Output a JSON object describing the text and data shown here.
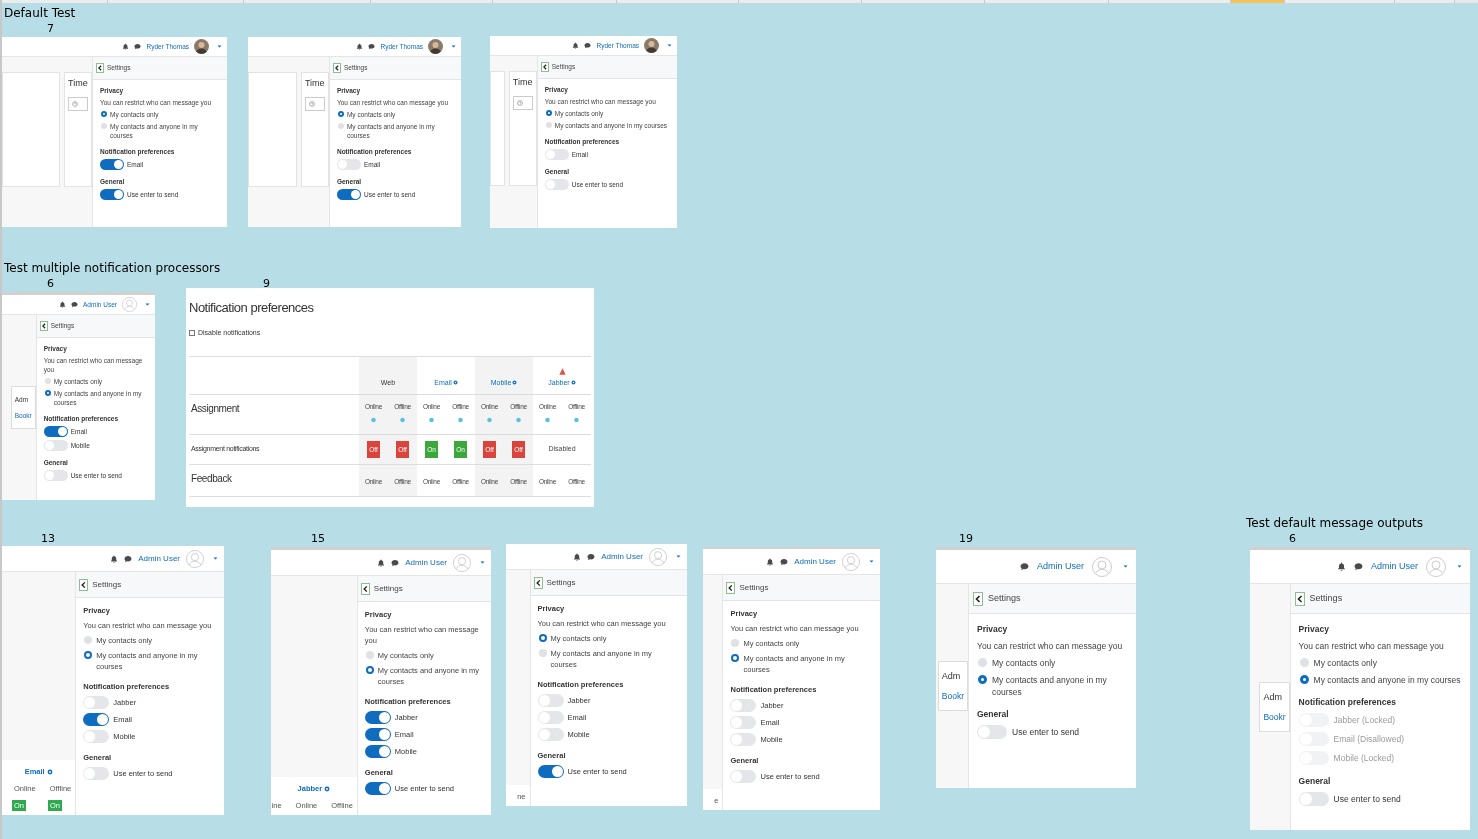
{
  "sheet": {
    "columns": [
      {
        "selected": false
      },
      {
        "selected": false
      },
      {
        "selected": false
      },
      {
        "selected": false
      },
      {
        "selected": false
      },
      {
        "selected": false
      },
      {
        "selected": false
      },
      {
        "selected": false
      },
      {
        "selected": false
      },
      {
        "selected": false
      },
      {
        "selected": true
      },
      {
        "selected": false
      },
      {
        "selected": false
      }
    ]
  },
  "groups": [
    {
      "title": "Default Test",
      "shots": [
        {
          "kind": "settings",
          "label": "7",
          "bell": true,
          "user": "Ryder Thomas",
          "avatar_photo": true,
          "backdrop": [
            {
              "kind": "title",
              "text": "Time"
            }
          ],
          "settings_title": "Settings",
          "privacy": {
            "title": "Privacy",
            "hint": "You can restrict who can message you",
            "options": [
              {
                "label": "My contacts only",
                "selected": true
              },
              {
                "label": "My contacts and anyone in my courses",
                "selected": false
              }
            ]
          },
          "notifications": {
            "title": "Notification preferences",
            "toggles": [
              {
                "label": "Email",
                "on": true
              }
            ]
          },
          "general": {
            "title": "General",
            "toggles": [
              {
                "label": "Use enter to send",
                "on": true
              }
            ]
          }
        },
        {
          "kind": "settings",
          "bell": true,
          "user": "Ryder Thomas",
          "avatar_photo": true,
          "backdrop": [
            {
              "kind": "title",
              "text": "Time"
            }
          ],
          "settings_title": "Settings",
          "privacy": {
            "title": "Privacy",
            "hint": "You can restrict who can message you",
            "options": [
              {
                "label": "My contacts only",
                "selected": true
              },
              {
                "label": "My contacts and anyone in my courses",
                "selected": false
              }
            ]
          },
          "notifications": {
            "title": "Notification preferences",
            "toggles": [
              {
                "label": "Email",
                "on": false
              }
            ]
          },
          "general": {
            "title": "General",
            "toggles": [
              {
                "label": "Use enter to send",
                "on": true
              }
            ]
          }
        },
        {
          "kind": "settings",
          "bell": true,
          "user": "Ryder Thomas",
          "avatar_photo": true,
          "backdrop": [
            {
              "kind": "title",
              "text": "Time"
            }
          ],
          "settings_title": "Settings",
          "privacy": {
            "title": "Privacy",
            "hint": "You can restrict who can message you",
            "options": [
              {
                "label": "My contacts only",
                "selected": true
              },
              {
                "label": "My contacts and anyone in my courses",
                "selected": false
              }
            ]
          },
          "notifications": {
            "title": "Notification preferences",
            "toggles": [
              {
                "label": "Email",
                "on": false
              }
            ]
          },
          "general": {
            "title": "General",
            "toggles": [
              {
                "label": "Use enter to send",
                "on": false
              }
            ]
          }
        }
      ]
    },
    {
      "title": "Test multiple notification processors",
      "shots": [
        {
          "kind": "settings",
          "label": "6",
          "bell": true,
          "user": "Admin User",
          "avatar_photo": false,
          "backdrop": [
            {
              "kind": "card_heading",
              "text": "Adm"
            },
            {
              "kind": "card_link",
              "text": "Bookr"
            }
          ],
          "settings_title": "Settings",
          "privacy": {
            "title": "Privacy",
            "hint": "You can restrict who can message you",
            "options": [
              {
                "label": "My contacts only",
                "selected": false
              },
              {
                "label": "My contacts and anyone in my courses",
                "selected": true
              }
            ]
          },
          "notifications": {
            "title": "Notification preferences",
            "toggles": [
              {
                "label": "Email",
                "on": true
              },
              {
                "label": "Mobile",
                "on": false
              }
            ]
          },
          "general": {
            "title": "General",
            "toggles": [
              {
                "label": "Use enter to send",
                "on": false
              }
            ]
          }
        },
        {
          "kind": "prefs_table",
          "label": "9",
          "title": "Notification preferences",
          "disable_label": "Disable notifications",
          "disable_checked": false,
          "processors": [
            {
              "name": "Web",
              "configurable": false,
              "warning": false
            },
            {
              "name": "Email",
              "configurable": true,
              "warning": false
            },
            {
              "name": "Mobile",
              "configurable": true,
              "warning": false
            },
            {
              "name": "Jabber",
              "configurable": true,
              "warning": true
            }
          ],
          "rows": [
            {
              "kind": "component",
              "name": "Assignment",
              "help": true,
              "cells": [
                "Online",
                "Offline",
                "Online",
                "Offline",
                "Online",
                "Offline",
                "Online",
                "Offline"
              ]
            },
            {
              "kind": "setting",
              "name": "Assignment notifications",
              "cells": [
                {
                  "kind": "toggle",
                  "text": "Off",
                  "on": false
                },
                {
                  "kind": "toggle",
                  "text": "Off",
                  "on": false
                },
                {
                  "kind": "toggle",
                  "text": "On",
                  "on": true
                },
                {
                  "kind": "toggle",
                  "text": "On",
                  "on": true
                },
                {
                  "kind": "toggle",
                  "text": "Off",
                  "on": false
                },
                {
                  "kind": "toggle",
                  "text": "Off",
                  "on": false
                },
                {
                  "kind": "disabled",
                  "text": "Disabled"
                }
              ]
            },
            {
              "kind": "component",
              "name": "Feedback",
              "help": false,
              "cells": [
                "Online",
                "Offline",
                "Online",
                "Offline",
                "Online",
                "Offline",
                "Online",
                "Offline"
              ]
            }
          ]
        },
        {
          "kind": "settings",
          "label": "13",
          "bell": true,
          "user": "Admin User",
          "avatar_photo": false,
          "backdrop": [
            {
              "kind": "column_head",
              "text": "Email"
            },
            {
              "kind": "cell",
              "text": "Online"
            },
            {
              "kind": "cell",
              "text": "Offline"
            },
            {
              "kind": "on_button",
              "text": "On"
            },
            {
              "kind": "on_button",
              "text": "On"
            }
          ],
          "settings_title": "Settings",
          "privacy": {
            "title": "Privacy",
            "hint": "You can restrict who can message you",
            "options": [
              {
                "label": "My contacts only",
                "selected": false
              },
              {
                "label": "My contacts and anyone in my courses",
                "selected": true
              }
            ]
          },
          "notifications": {
            "title": "Notification preferences",
            "toggles": [
              {
                "label": "Jabber",
                "on": false
              },
              {
                "label": "Email",
                "on": true
              },
              {
                "label": "Mobile",
                "on": false
              }
            ]
          },
          "general": {
            "title": "General",
            "toggles": [
              {
                "label": "Use enter to send",
                "on": false
              }
            ]
          }
        },
        {
          "kind": "settings",
          "label": "15",
          "bell": true,
          "user": "Admin User",
          "avatar_photo": false,
          "backdrop": [
            {
              "kind": "column_head",
              "text": "Jabber"
            },
            {
              "kind": "cell",
              "text": "ine"
            },
            {
              "kind": "cell",
              "text": "Online"
            },
            {
              "kind": "cell",
              "text": "Offline"
            }
          ],
          "settings_title": "Settings",
          "privacy": {
            "title": "Privacy",
            "hint": "You can restrict who can message you",
            "options": [
              {
                "label": "My contacts only",
                "selected": false
              },
              {
                "label": "My contacts and anyone in my courses",
                "selected": true
              }
            ]
          },
          "notifications": {
            "title": "Notification preferences",
            "toggles": [
              {
                "label": "Jabber",
                "on": true
              },
              {
                "label": "Email",
                "on": true
              },
              {
                "label": "Mobile",
                "on": true
              }
            ]
          },
          "general": {
            "title": "General",
            "toggles": [
              {
                "label": "Use enter to send",
                "on": true
              }
            ]
          }
        },
        {
          "kind": "settings",
          "bell": true,
          "user": "Admin User",
          "avatar_photo": false,
          "backdrop": [
            {
              "kind": "cell",
              "text": "ne"
            }
          ],
          "settings_title": "Settings",
          "privacy": {
            "title": "Privacy",
            "hint": "You can restrict who can message you",
            "options": [
              {
                "label": "My contacts only",
                "selected": true
              },
              {
                "label": "My contacts and anyone in my courses",
                "selected": false
              }
            ]
          },
          "notifications": {
            "title": "Notification preferences",
            "toggles": [
              {
                "label": "Jabber",
                "on": false
              },
              {
                "label": "Email",
                "on": false
              },
              {
                "label": "Mobile",
                "on": false
              }
            ]
          },
          "general": {
            "title": "General",
            "toggles": [
              {
                "label": "Use enter to send",
                "on": true
              }
            ]
          }
        },
        {
          "kind": "settings",
          "bell": true,
          "user": "Admin User",
          "avatar_photo": false,
          "backdrop": [
            {
              "kind": "cell",
              "text": "e"
            }
          ],
          "settings_title": "Settings",
          "privacy": {
            "title": "Privacy",
            "hint": "You can restrict who can message you",
            "options": [
              {
                "label": "My contacts only",
                "selected": false
              },
              {
                "label": "My contacts and anyone in my courses",
                "selected": true
              }
            ]
          },
          "notifications": {
            "title": "Notification preferences",
            "toggles": [
              {
                "label": "Jabber",
                "on": false
              },
              {
                "label": "Email",
                "on": false
              },
              {
                "label": "Mobile",
                "on": false
              }
            ]
          },
          "general": {
            "title": "General",
            "toggles": [
              {
                "label": "Use enter to send",
                "on": false
              }
            ]
          }
        },
        {
          "kind": "settings",
          "label": "19",
          "bell": false,
          "user": "Admin User",
          "avatar_photo": false,
          "backdrop": [
            {
              "kind": "card_heading",
              "text": "Adm"
            },
            {
              "kind": "card_link",
              "text": "Bookr"
            }
          ],
          "settings_title": "Settings",
          "privacy": {
            "title": "Privacy",
            "hint": "You can restrict who can message you",
            "options": [
              {
                "label": "My contacts only",
                "selected": false
              },
              {
                "label": "My contacts and anyone in my courses",
                "selected": true
              }
            ]
          },
          "general": {
            "title": "General",
            "toggles": [
              {
                "label": "Use enter to send",
                "on": false
              }
            ]
          }
        }
      ]
    },
    {
      "title": "Test default message outputs",
      "shots": [
        {
          "kind": "settings",
          "label": "6",
          "bell": true,
          "user": "Admin User",
          "avatar_photo": false,
          "backdrop": [
            {
              "kind": "card_heading",
              "text": "Adm"
            },
            {
              "kind": "card_link",
              "text": "Bookr"
            }
          ],
          "settings_title": "Settings",
          "privacy": {
            "title": "Privacy",
            "hint": "You can restrict who can message you",
            "options": [
              {
                "label": "My contacts only",
                "selected": false
              },
              {
                "label": "My contacts and anyone in my courses",
                "selected": true
              }
            ]
          },
          "notifications": {
            "title": "Notification preferences",
            "toggles": [
              {
                "label": "Jabber (Locked)",
                "on": false,
                "disabled": true
              },
              {
                "label": "Email (Disallowed)",
                "on": false,
                "disabled": true
              },
              {
                "label": "Mobile (Locked)",
                "on": false,
                "disabled": true
              }
            ]
          },
          "general": {
            "title": "General",
            "toggles": [
              {
                "label": "Use enter to send",
                "on": false
              }
            ]
          }
        }
      ]
    }
  ]
}
